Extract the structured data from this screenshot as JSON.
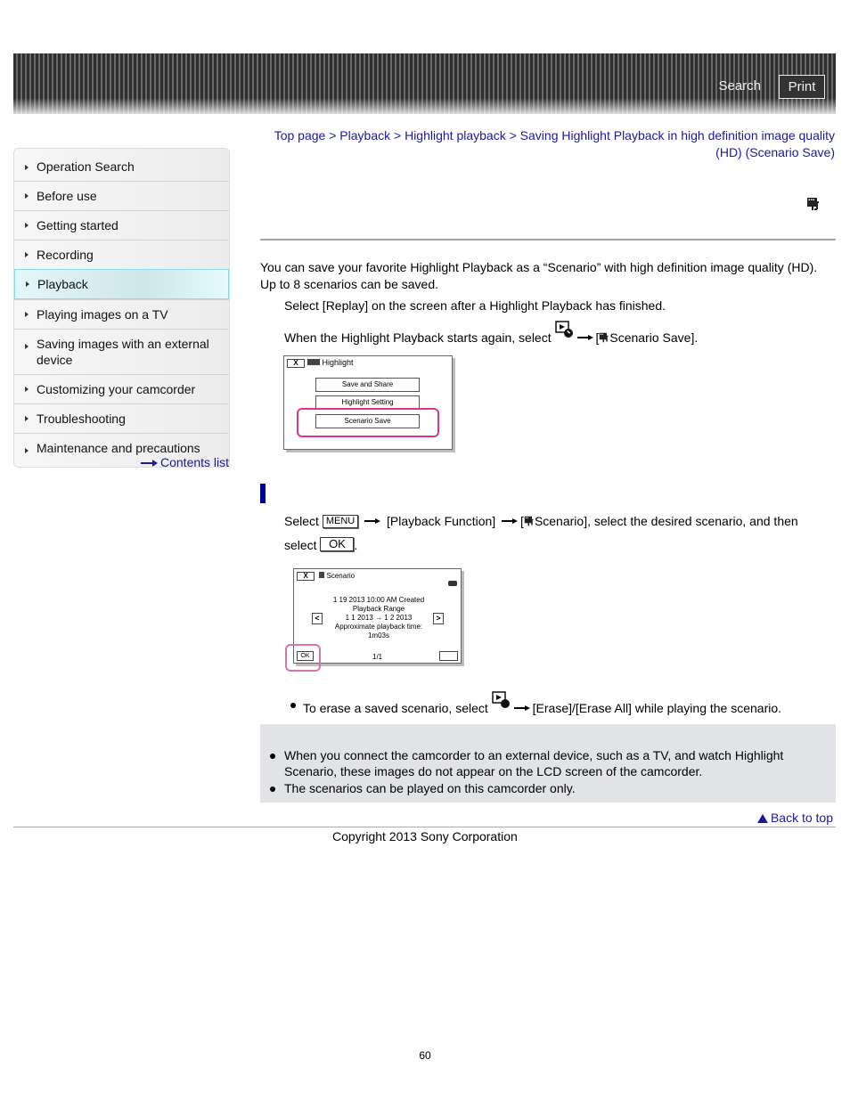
{
  "header": {
    "search_label": "Search",
    "print_label": "Print"
  },
  "sidebar": {
    "items": [
      {
        "label": "Operation Search",
        "active": false
      },
      {
        "label": "Before use",
        "active": false
      },
      {
        "label": "Getting started",
        "active": false
      },
      {
        "label": "Recording",
        "active": false
      },
      {
        "label": "Playback",
        "active": true
      },
      {
        "label": "Playing images on a TV",
        "active": false
      },
      {
        "label": "Saving images with an external device",
        "active": false
      },
      {
        "label": "Customizing your camcorder",
        "active": false
      },
      {
        "label": "Troubleshooting",
        "active": false
      },
      {
        "label": "Maintenance and precautions",
        "active": false
      }
    ],
    "contents_link": "Contents list"
  },
  "breadcrumb": {
    "items": [
      "Top page",
      "Playback",
      "Highlight playback",
      "Saving Highlight Playback in high definition image quality (HD) (Scenario Save)"
    ],
    "separator": " > "
  },
  "title_icon": "scenario-icon",
  "intro": "You can save your favorite Highlight Playback as a “Scenario” with high definition image quality (HD). Up to 8 scenarios can be saved.",
  "steps": {
    "step1": "Select [Replay] on the screen after a Highlight Playback has finished.",
    "step2_prefix": "When the Highlight Playback starts again, select",
    "step2_suffix": "Scenario Save]."
  },
  "screen1": {
    "close": "X",
    "title": "Highlight",
    "buttons": [
      "Save and Share",
      "Highlight Setting",
      "Scenario Save"
    ]
  },
  "section2": {
    "select": "Select",
    "menu_key": "MENU",
    "playback_function": "[Playback Function]",
    "scenario_suffix": "Scenario], select the desired scenario, and then",
    "select2": "select",
    "ok_key": "OK"
  },
  "screen2": {
    "close": "X",
    "title": "Scenario",
    "created": "1 19 2013  10:00 AM Created",
    "range_label": "Playback Range",
    "range": "1  1 2013 →  1  2 2013",
    "approx_label": "Approximate playback time:",
    "duration": "1m03s",
    "ok": "OK",
    "page": "1/1",
    "prev": "<",
    "next": ">"
  },
  "erase_note": {
    "prefix": "To erase a saved scenario, select",
    "suffix": "[Erase]/[Erase All] while playing the scenario."
  },
  "notes": [
    "When you connect the camcorder to an external device, such as a TV, and watch Highlight Scenario, these images do not appear on the LCD screen of the camcorder.",
    "The scenarios can be played on this camcorder only."
  ],
  "back_to_top": "Back to top",
  "copyright": "Copyright 2013 Sony Corporation",
  "page_number": "60",
  "colors": {
    "link": "#1a1aa0",
    "section_bar": "#000096",
    "highlight_frame": "#e0338c",
    "note_bg": "#e1e3e6"
  }
}
